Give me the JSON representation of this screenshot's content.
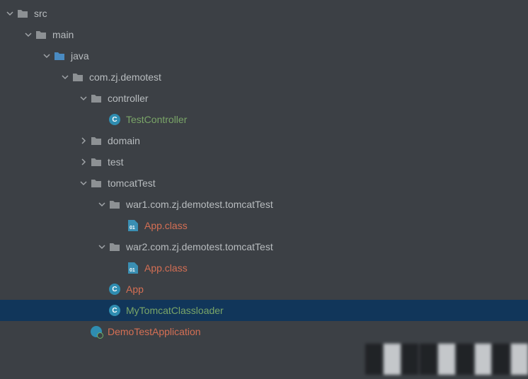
{
  "tree": {
    "src": "src",
    "main": "main",
    "java": "java",
    "pkg_root": "com.zj.demotest",
    "controller": "controller",
    "test_controller": "TestController",
    "domain": "domain",
    "test": "test",
    "tomcat_test": "tomcatTest",
    "war1": "war1.com.zj.demotest.tomcatTest",
    "app_class_1": "App.class",
    "war2": "war2.com.zj.demotest.tomcatTest",
    "app_class_2": "App.class",
    "app": "App",
    "my_tomcat_classloader": "MyTomcatClassloader",
    "demo_app": "DemoTestApplication"
  }
}
